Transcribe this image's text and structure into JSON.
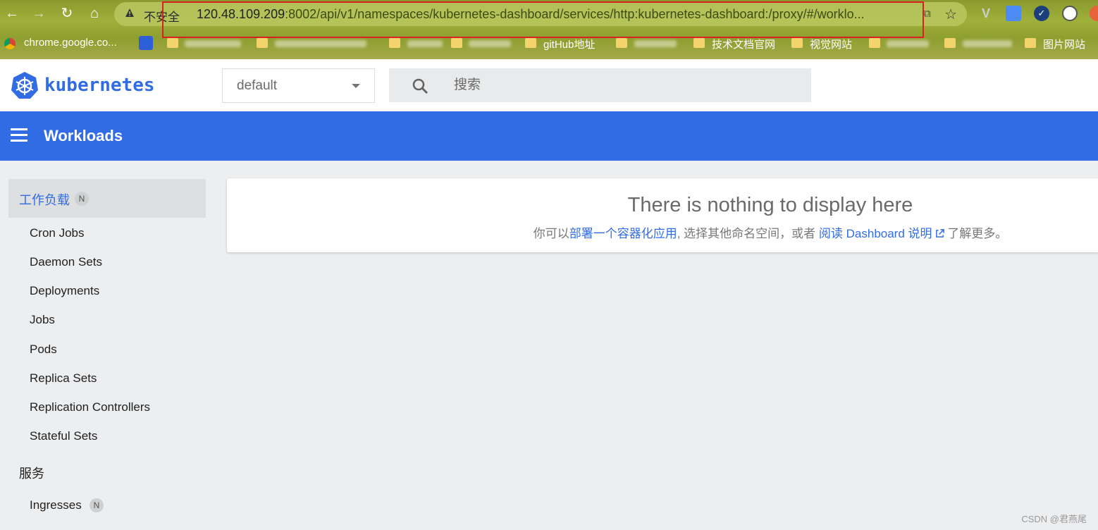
{
  "browser": {
    "nav": {
      "back_icon": "arrow-left-icon",
      "forward_icon": "arrow-right-icon",
      "reload_icon": "reload-icon",
      "home_icon": "home-icon"
    },
    "omnibox": {
      "security_label": "不安全",
      "url_host": "120.48.109.209",
      "url_rest": ":8002/api/v1/namespaces/kubernetes-dashboard/services/http:kubernetes-dashboard:/proxy/#/worklo..."
    },
    "bookmarks": [
      {
        "label": "chrome.google.co..."
      },
      {
        "label": "gitHub地址"
      },
      {
        "label": "技术文档官网"
      },
      {
        "label": "视觉网站"
      },
      {
        "label": "图片网站"
      }
    ]
  },
  "app": {
    "brand": "kubernetes",
    "namespace": {
      "selected": "default"
    },
    "search": {
      "placeholder": "搜索"
    },
    "toolbar": {
      "title": "Workloads"
    },
    "sidebar": {
      "active": {
        "label": "工作负载",
        "badge": "N"
      },
      "items": [
        "Cron Jobs",
        "Daemon Sets",
        "Deployments",
        "Jobs",
        "Pods",
        "Replica Sets",
        "Replication Controllers",
        "Stateful Sets"
      ],
      "section_services": "服务",
      "ingresses": {
        "label": "Ingresses",
        "badge": "N"
      }
    },
    "empty_state": {
      "title": "There is nothing to display here",
      "prefix": "你可以",
      "deploy_link": "部署一个容器化应用",
      "middle": ", 选择其他命名空间，或者 ",
      "docs_link": "阅读 Dashboard 说明",
      "suffix": " 了解更多。"
    }
  },
  "watermark": "CSDN @君燕尾",
  "colors": {
    "accent": "#326ce5",
    "highlight": "#d62222"
  }
}
